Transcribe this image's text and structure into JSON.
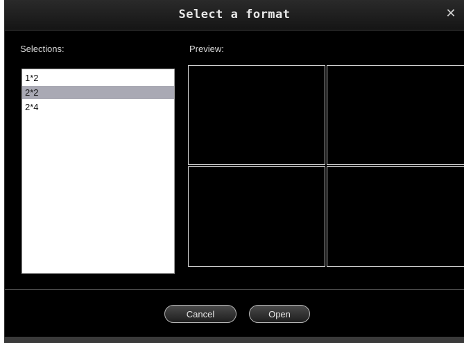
{
  "dialog": {
    "title": "Select a format",
    "close_icon": "close-icon",
    "close_glyph": "✕"
  },
  "selections": {
    "label": "Selections:",
    "items": [
      {
        "label": "1*2",
        "selected": false
      },
      {
        "label": "2*2",
        "selected": true
      },
      {
        "label": "2*4",
        "selected": false
      }
    ]
  },
  "preview": {
    "label": "Preview:",
    "layout": "2*2",
    "cell_count": 4
  },
  "buttons": {
    "cancel": "Cancel",
    "open": "Open"
  },
  "colors": {
    "background": "#000000",
    "selected_item": "#a9a9b4",
    "preview_border": "#cfcfcf"
  }
}
